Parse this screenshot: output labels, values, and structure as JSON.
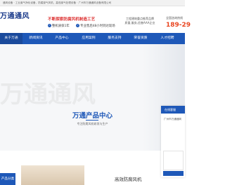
{
  "topbar": {
    "text": "通风设备 · 工业废气净化设备，防腐废气风机，高低废气处理设备 · 广州市万通通风设备有限公司"
  },
  "header": {
    "logo_text": "万通通风",
    "slogan_prefix": "不断探索",
    "slogan_brand": "防腐风机",
    "slogan_suffix": "制造工艺",
    "promises": [
      {
        "label": "整机质保1年"
      },
      {
        "label": "专业售后48小时到达现场"
      }
    ],
    "engineers_line1": "工程建筑重点推荐品牌",
    "engineers_line2": "质量,服务,信誉AAA企业",
    "hotline_label": "全国咨询热线",
    "hotline_number": "189-29"
  },
  "nav": {
    "items": [
      {
        "label": "关于万通"
      },
      {
        "label": "新闻资讯"
      },
      {
        "label": "产品中心"
      },
      {
        "label": "应用案例"
      },
      {
        "label": "服务支持"
      },
      {
        "label": "荣誉资质"
      },
      {
        "label": "人才招聘"
      }
    ],
    "active_index": 0
  },
  "banner": {
    "watermark": "万通通风"
  },
  "products_section": {
    "title": "万通产品中心",
    "subtitle": "专注防腐风机研发与生产",
    "category_tab": "产品分类",
    "featured_product": "高效防腐风机"
  },
  "chat": {
    "title": "在线客服",
    "message": "广州市万通通风"
  },
  "colors": {
    "brand_blue": "#1e58b8",
    "hotline_orange": "#e94520",
    "slogan_red": "#d33"
  }
}
